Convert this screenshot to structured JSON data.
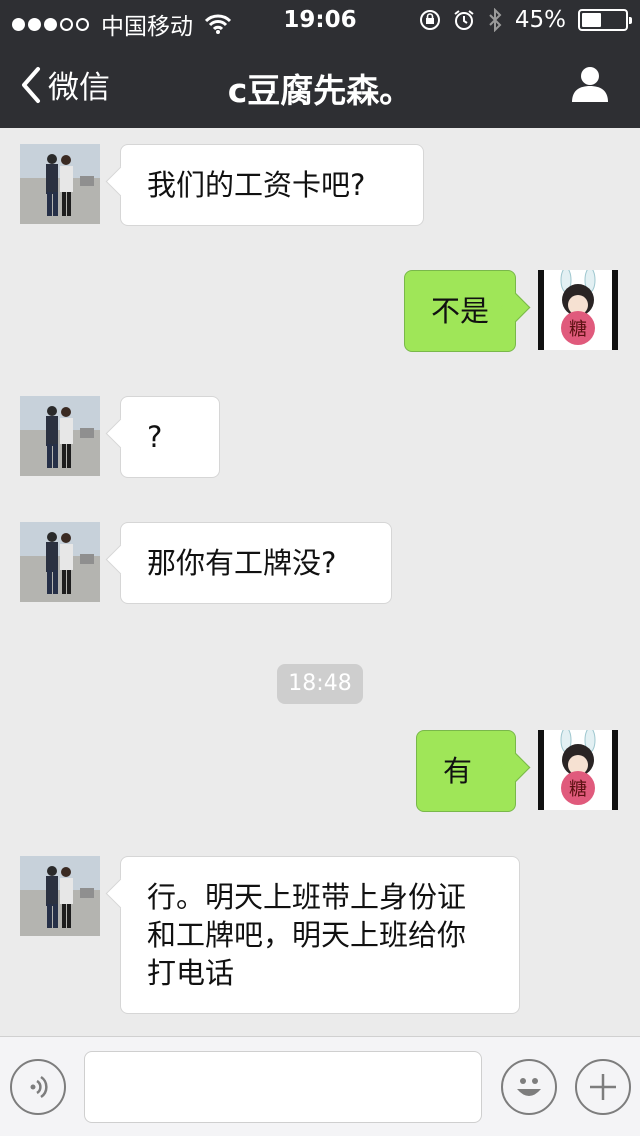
{
  "status_bar": {
    "carrier": "中国移动",
    "time": "19:06",
    "battery_percent": "45%",
    "battery_level": 0.45,
    "signal_dots_filled": 3,
    "signal_dots_total": 5
  },
  "nav": {
    "back_label": "微信",
    "title": "c豆腐先森。",
    "profile_icon": "person-icon"
  },
  "messages": [
    {
      "side": "in",
      "text": "我们的工资卡吧?"
    },
    {
      "side": "out",
      "text": "不是"
    },
    {
      "side": "in",
      "text": "?"
    },
    {
      "side": "in",
      "text": "那你有工牌没?"
    },
    {
      "side": "out",
      "text": "有"
    },
    {
      "side": "in",
      "text": "行。明天上班带上身份证和工牌吧，明天上班给你打电话"
    }
  ],
  "timestamp": "18:48",
  "input_bar": {
    "value": "",
    "voice_icon": "voice-icon",
    "emoji_icon": "emoji-icon",
    "plus_icon": "plus-icon"
  },
  "colors": {
    "nav_background": "#2e2f33",
    "chat_background": "#ebebeb",
    "outgoing_bubble": "#9fe658",
    "incoming_bubble": "#ffffff"
  }
}
